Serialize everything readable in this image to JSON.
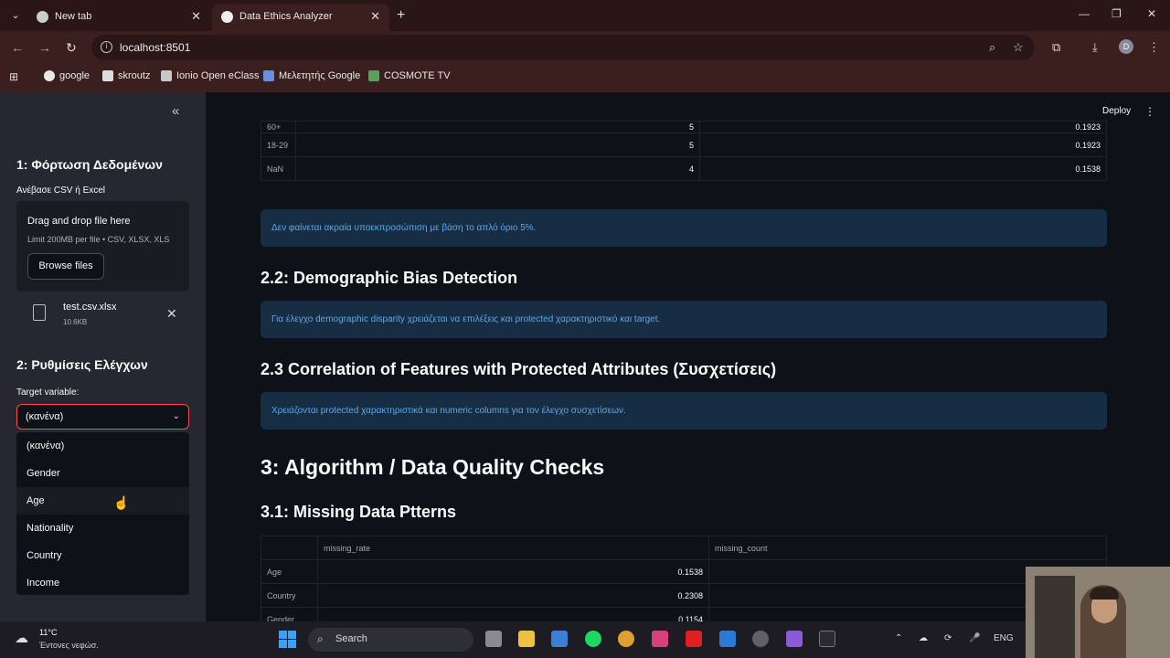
{
  "browser": {
    "tabs": [
      {
        "label": "New tab",
        "active": false
      },
      {
        "label": "Data Ethics Analyzer",
        "active": true
      }
    ],
    "url": "localhost:8501",
    "profile_initial": "D",
    "bookmarks": [
      {
        "label": "google"
      },
      {
        "label": "skroutz"
      },
      {
        "label": "Ionio Open eClass"
      },
      {
        "label": "Μελετητής Google"
      },
      {
        "label": "COSMOTE TV"
      }
    ]
  },
  "sidebar": {
    "section1_title": "1: Φόρτωση Δεδομένων",
    "upload_label": "Ανέβασε CSV ή Excel",
    "upload_title": "Drag and drop file here",
    "upload_limits": "Limit 200MB per file • CSV, XLSX, XLS",
    "browse_label": "Browse files",
    "file_name": "test.csv.xlsx",
    "file_size": "10.6KB",
    "section2_title": "2: Ρυθμίσεις Ελέγχων",
    "target_label": "Target variable:",
    "target_value": "(κανένα)",
    "options": [
      "(κανένα)",
      "Gender",
      "Age",
      "Nationality",
      "Country",
      "Income"
    ]
  },
  "main": {
    "deploy_label": "Deploy",
    "top_table": {
      "rows": [
        {
          "label": "60+",
          "count": "5",
          "rate": "0.1923"
        },
        {
          "label": "18-29",
          "count": "5",
          "rate": "0.1923"
        },
        {
          "label": "NaN",
          "count": "4",
          "rate": "0.1538"
        }
      ]
    },
    "info_representation": "Δεν φαίνεται ακραία υποεκπροσώπιση με βάση το απλό όριο 5%.",
    "h_demographic": "2.2: Demographic Bias Detection",
    "info_demographic": "Για έλεγχο demographic disparity χρειάζεται να επιλέξεις και protected χαρακτηριστικό και target.",
    "h_correlation": "2.3 Correlation of Features with Protected Attributes (Συσχετίσεις)",
    "info_correlation": "Χρειάζονται protected χαρακτηριστικά και numeric columns για τον έλεγχο συσχετίσεων.",
    "h_algorithm": "3: Algorithm / Data Quality Checks",
    "h_missing": "3.1: Missing Data Ptterns",
    "missing_table": {
      "columns": [
        "missing_rate",
        "missing_count"
      ],
      "rows": [
        {
          "label": "Age",
          "rate": "0.1538",
          "count": ""
        },
        {
          "label": "Country",
          "rate": "0.2308",
          "count": ""
        },
        {
          "label": "Gender",
          "rate": "0.1154",
          "count": ""
        }
      ]
    }
  },
  "taskbar": {
    "temperature": "11°C",
    "condition": "Έντονες νεφώσ.",
    "search_label": "Search",
    "language": "ENG"
  }
}
